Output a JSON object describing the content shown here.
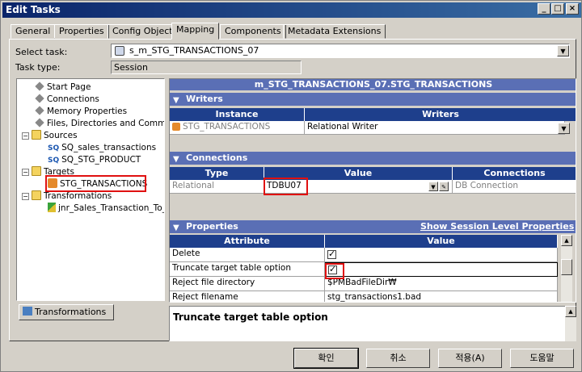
{
  "window": {
    "title": "Edit Tasks"
  },
  "tabs": [
    "General",
    "Properties",
    "Config Object",
    "Mapping",
    "Components",
    "Metadata Extensions"
  ],
  "active_tab": "Mapping",
  "select_task": {
    "label": "Select task:",
    "value": "s_m_STG_TRANSACTIONS_07"
  },
  "task_type": {
    "label": "Task type:",
    "value": "Session"
  },
  "tree": {
    "start_page": "Start Page",
    "connections": "Connections",
    "memory_properties": "Memory Properties",
    "files": "Files, Directories and Commands",
    "sources": "Sources",
    "source_items": [
      "SQ_sales_transactions",
      "SQ_STG_PRODUCT"
    ],
    "sq_badge": "SQ",
    "targets": "Targets",
    "target_item": "STG_TRANSACTIONS",
    "transformations": "Transformations",
    "transformation_item": "jnr_Sales_Transaction_To_"
  },
  "bottom_tab": "Transformations",
  "mapping_title": "m_STG_TRANSACTIONS_07.STG_TRANSACTIONS",
  "writers": {
    "section": "Writers",
    "col_instance": "Instance",
    "col_writers": "Writers",
    "instance": "STG_TRANSACTIONS",
    "writer": "Relational Writer"
  },
  "connections": {
    "section": "Connections",
    "col_type": "Type",
    "col_value": "Value",
    "col_connections": "Connections",
    "type": "Relational",
    "value": "TDBU07",
    "conn": "DB Connection"
  },
  "properties": {
    "section": "Properties",
    "link": "Show Session Level Properties",
    "col_attribute": "Attribute",
    "col_value": "Value",
    "rows": [
      {
        "attr": "Delete",
        "value": ""
      },
      {
        "attr": "Truncate target table option",
        "value": ""
      },
      {
        "attr": "Reject file directory",
        "value": "$PMBadFileDir₩"
      },
      {
        "attr": "Reject filename",
        "value": "stg_transactions1.bad"
      }
    ]
  },
  "description": {
    "title": "Truncate target table option"
  },
  "buttons": {
    "ok": "확인",
    "cancel": "취소",
    "apply": "적용(A)",
    "help": "도움말"
  }
}
